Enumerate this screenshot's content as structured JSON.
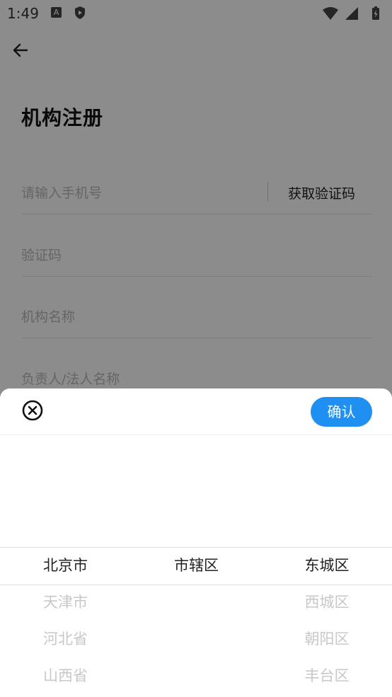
{
  "status_bar": {
    "time": "1:49",
    "notif_icon_letter": "A"
  },
  "page": {
    "title": "机构注册",
    "phone_placeholder": "请输入手机号",
    "get_code_label": "获取验证码",
    "code_placeholder": "验证码",
    "org_name_placeholder": "机构名称",
    "legal_name_placeholder": "负责人/法人名称"
  },
  "picker": {
    "confirm_label": "确认",
    "accent_color": "#1f8ff2",
    "provinces": [
      "北京市",
      "天津市",
      "河北省",
      "山西省"
    ],
    "cities": [
      "市辖区"
    ],
    "districts": [
      "东城区",
      "西城区",
      "朝阳区",
      "丰台区"
    ]
  }
}
